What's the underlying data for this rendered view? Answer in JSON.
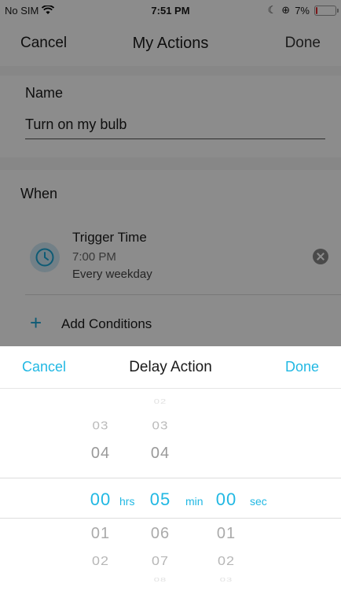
{
  "status_bar": {
    "carrier": "No SIM",
    "time": "7:51 PM",
    "battery": "7%",
    "battery_level": 0.07
  },
  "nav": {
    "cancel": "Cancel",
    "title": "My Actions",
    "done": "Done"
  },
  "name_section": {
    "label": "Name",
    "value": "Turn on my bulb"
  },
  "when_section": {
    "label": "When",
    "trigger": {
      "title": "Trigger Time",
      "time": "7:00 PM",
      "repeat": "Every weekday"
    },
    "add_conditions": "Add Conditions"
  },
  "delay_sheet": {
    "cancel": "Cancel",
    "title": "Delay Action",
    "done": "Done",
    "hours": {
      "above": [
        "03",
        "04"
      ],
      "selected": "00",
      "below": [
        "01",
        "02"
      ],
      "unit": "hrs"
    },
    "minutes": {
      "above": [
        "02",
        "03",
        "04"
      ],
      "selected": "05",
      "below": [
        "06",
        "07",
        "08"
      ],
      "unit": "min"
    },
    "seconds": {
      "above": [],
      "selected": "00",
      "below": [
        "01",
        "02",
        "03"
      ],
      "unit": "sec"
    }
  },
  "colors": {
    "accent": "#21b8e3",
    "battery_low": "#e2282c"
  }
}
